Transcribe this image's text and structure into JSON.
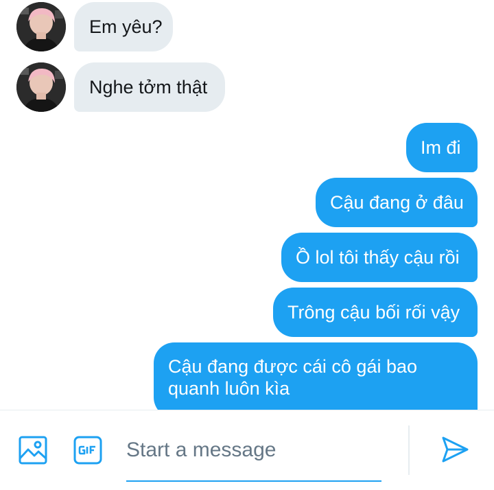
{
  "messages": [
    {
      "sender": "other",
      "text": "Em yêu?"
    },
    {
      "sender": "other",
      "text": "Nghe tởm thật"
    },
    {
      "sender": "me",
      "text": "Im đi"
    },
    {
      "sender": "me",
      "text": "Cậu đang ở đâu"
    },
    {
      "sender": "me",
      "text": "Ồ lol tôi thấy cậu rồi"
    },
    {
      "sender": "me",
      "text": "Trông cậu bối rối vậy"
    },
    {
      "sender": "me",
      "text": "Cậu đang được cái cô gái bao quanh luôn kìa"
    }
  ],
  "composer": {
    "placeholder": "Start a message",
    "icons": {
      "media": "image-icon",
      "gif": "gif-icon",
      "send": "send-icon"
    }
  },
  "colors": {
    "accent": "#1da1f2",
    "incoming_bubble": "#e6ecf0",
    "incoming_text": "#14171a",
    "outgoing_text": "#ffffff",
    "placeholder": "#657786"
  }
}
